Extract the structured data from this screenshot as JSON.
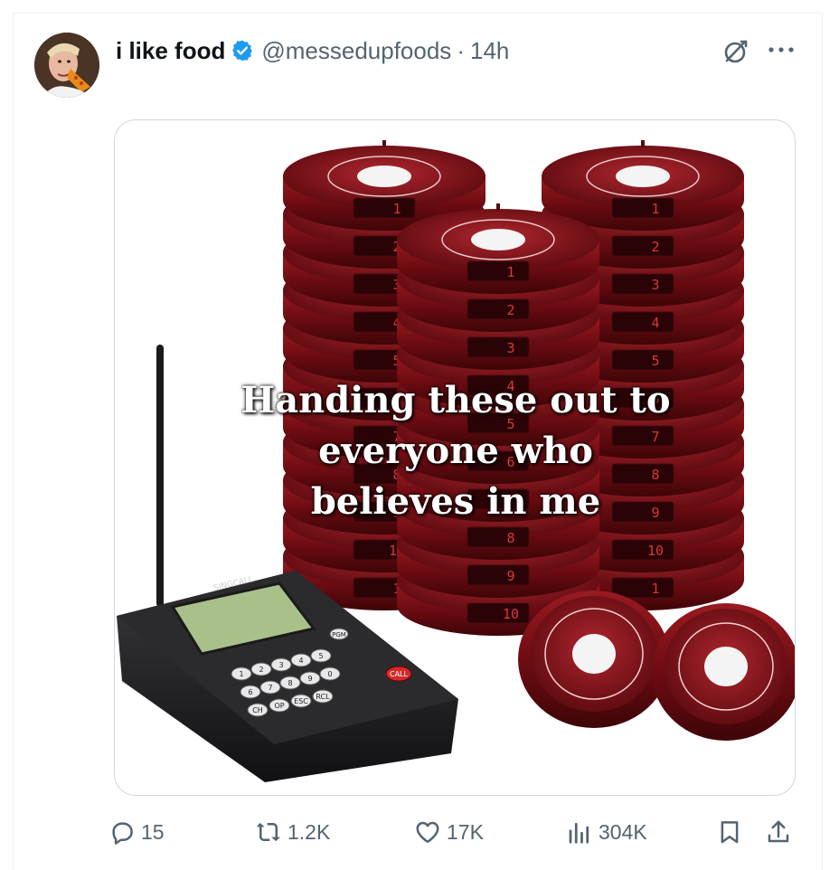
{
  "tweet": {
    "display_name": "i like food",
    "handle": "@messedupfoods",
    "separator": "·",
    "time": "14h",
    "verified": true
  },
  "media": {
    "caption_lines": [
      "Handing these out to",
      "everyone who",
      "believes in me"
    ],
    "pager_numbers": [
      "1",
      "2",
      "3",
      "4",
      "5",
      "6",
      "7",
      "8",
      "9",
      "10"
    ],
    "keypad_keys": [
      "1",
      "2",
      "3",
      "4",
      "5",
      "6",
      "7",
      "8",
      "9",
      "0",
      "CH",
      "OP",
      "ESC",
      "RCL",
      "PGM",
      "CALL"
    ],
    "brand": "SINGCALL"
  },
  "actions": {
    "replies": "15",
    "reposts": "1.2K",
    "likes": "17K",
    "views": "304K"
  },
  "icons": {
    "verified": "verified-badge-icon",
    "grok": "grok-icon",
    "more": "more-options-icon",
    "reply": "reply-icon",
    "repost": "repost-icon",
    "like": "heart-icon",
    "views": "views-chart-icon",
    "bookmark": "bookmark-icon",
    "share": "share-icon"
  },
  "colors": {
    "text": "#0f1419",
    "secondary": "#536471",
    "verified_blue": "#1d9bf0",
    "pager_red": "#7a1016"
  }
}
